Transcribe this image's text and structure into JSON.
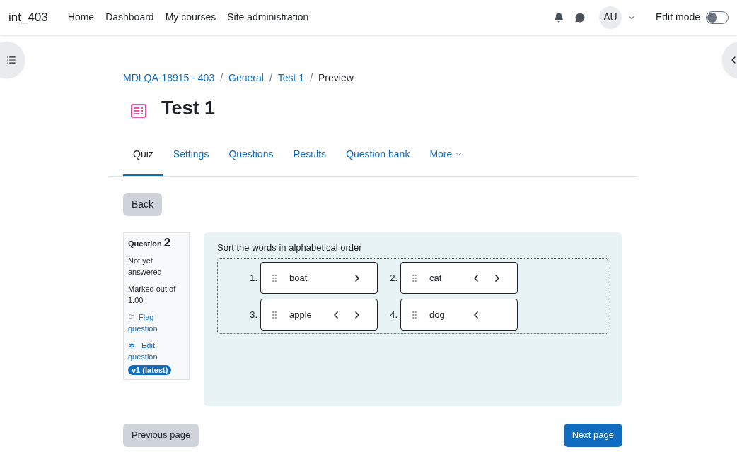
{
  "site_name": "int_403",
  "nav": [
    {
      "label": "Home"
    },
    {
      "label": "Dashboard"
    },
    {
      "label": "My courses"
    },
    {
      "label": "Site administration"
    }
  ],
  "user_initials": "AU",
  "edit_mode": {
    "label": "Edit mode",
    "on": false
  },
  "breadcrumb_separator": "/",
  "breadcrumb": [
    {
      "label": "MDLQA-18915 - 403",
      "link": true
    },
    {
      "label": "General",
      "link": true
    },
    {
      "label": "Test 1",
      "link": true
    },
    {
      "label": "Preview",
      "link": false
    }
  ],
  "title": "Test 1",
  "tabs": [
    {
      "label": "Quiz",
      "selected": true
    },
    {
      "label": "Settings",
      "selected": false
    },
    {
      "label": "Questions",
      "selected": false
    },
    {
      "label": "Results",
      "selected": false
    },
    {
      "label": "Question bank",
      "selected": false
    },
    {
      "label": "More",
      "selected": false
    }
  ],
  "back_button": "Back",
  "question_info": {
    "label": "Question",
    "number": "2",
    "status": "Not yet answered",
    "marked": "Marked out of 1.00",
    "flag": "Flag question",
    "edit": "Edit question",
    "version": "v1 (latest)"
  },
  "question": {
    "prompt": "Sort the words in alphabetical order",
    "items": [
      {
        "number": "1.",
        "word": "boat",
        "left": false,
        "right": true
      },
      {
        "number": "2.",
        "word": "cat",
        "left": true,
        "right": true
      },
      {
        "number": "3.",
        "word": "apple",
        "left": true,
        "right": true
      },
      {
        "number": "4.",
        "word": "dog",
        "left": true,
        "right": false
      }
    ]
  },
  "previous_button": "Previous page",
  "next_button": "Next page"
}
